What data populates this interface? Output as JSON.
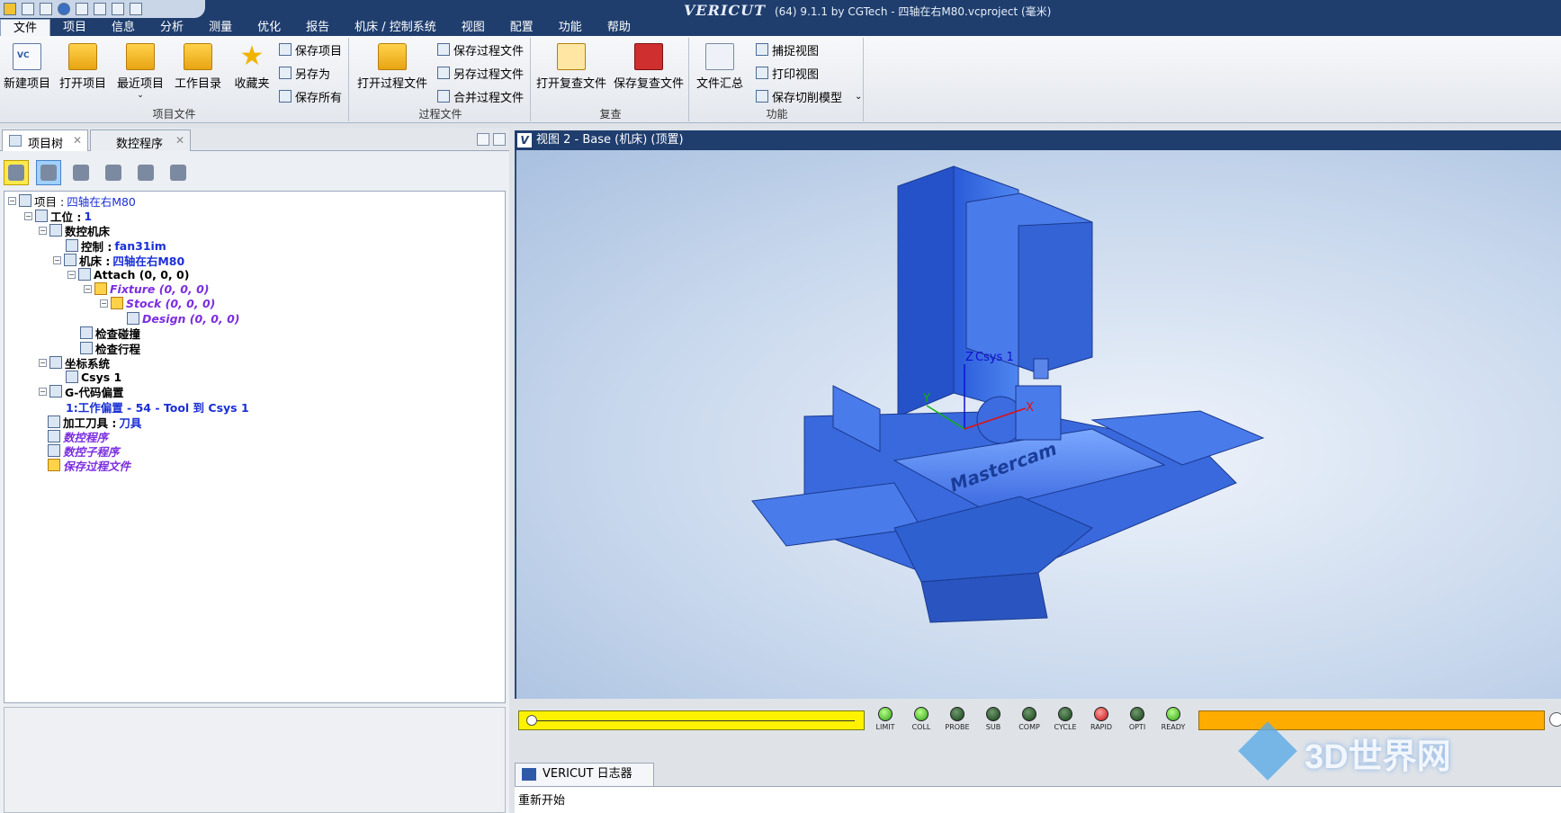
{
  "title": {
    "brand": "VERICUT",
    "text": "(64)  9.1.1 by CGTech - 四轴在右M80.vcproject (毫米)"
  },
  "menu": [
    "文件",
    "项目",
    "信息",
    "分析",
    "测量",
    "优化",
    "报告",
    "机床 / 控制系统",
    "视图",
    "配置",
    "功能",
    "帮助"
  ],
  "ribbon": {
    "project_group": {
      "label": "项目文件",
      "new": "新建项目",
      "open": "打开项目",
      "recent": "最近项目",
      "workdir": "工作目录",
      "favorites": "收藏夹",
      "save": "保存项目",
      "saveas": "另存为",
      "saveall": "保存所有"
    },
    "process_group": {
      "label": "过程文件",
      "open": "打开过程文件",
      "save": "保存过程文件",
      "saveas": "另存过程文件",
      "merge": "合并过程文件"
    },
    "review_group": {
      "label": "复查",
      "open": "打开复查文件",
      "save": "保存复查文件"
    },
    "function_group": {
      "label": "功能",
      "summary": "文件汇总",
      "capture": "捕捉视图",
      "print": "打印视图",
      "savecut": "保存切削模型"
    }
  },
  "left": {
    "tabs": [
      "项目树",
      "数控程序"
    ],
    "tree": {
      "project_label": "项目 : ",
      "project_value": "四轴在右M80",
      "setup_label": "工位 : ",
      "setup_value": "1",
      "machine": "数控机床",
      "control_label": "控制 : ",
      "control_value": "fan31im",
      "mach_label": "机床 : ",
      "mach_value": "四轴在右M80",
      "attach": "Attach (0, 0, 0)",
      "fixture": "Fixture (0, 0, 0)",
      "stock": "Stock (0, 0, 0)",
      "design": "Design (0, 0, 0)",
      "collision": "检查碰撞",
      "travel": "检查行程",
      "coord": "坐标系统",
      "csys": "Csys 1",
      "gcode": "G-代码偏置",
      "offset": "1:工作偏置 - 54 - Tool 到 Csys 1",
      "tools_label": "加工刀具 : ",
      "tools_value": "刀具",
      "ncprog": "数控程序",
      "ncsub": "数控子程序",
      "saveip": "保存过程文件"
    }
  },
  "view": {
    "title": "视图 2 - Base (机床) (顶置)",
    "axis_z": "Z",
    "axis_y": "Y",
    "axis_x": "X",
    "csys_label": "Csys 1",
    "logo": "Mastercam"
  },
  "leds": [
    {
      "name": "LIMIT",
      "color": "green"
    },
    {
      "name": "COLL",
      "color": "green"
    },
    {
      "name": "PROBE",
      "color": "dark"
    },
    {
      "name": "SUB",
      "color": "dark"
    },
    {
      "name": "COMP",
      "color": "dark"
    },
    {
      "name": "CYCLE",
      "color": "dark"
    },
    {
      "name": "RAPID",
      "color": "red"
    },
    {
      "name": "OPTI",
      "color": "dark"
    },
    {
      "name": "READY",
      "color": "green"
    }
  ],
  "log": {
    "tab": "VERICUT 日志器",
    "text": "重新开始"
  },
  "watermark": "3D世界网"
}
